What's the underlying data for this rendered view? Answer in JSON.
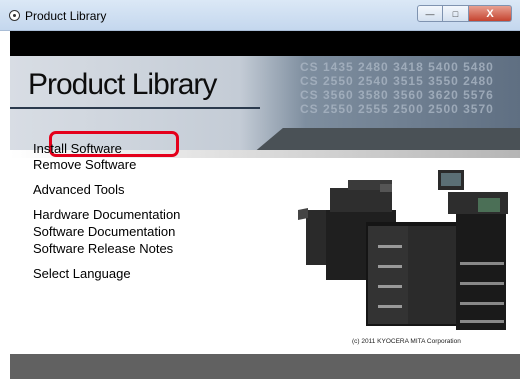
{
  "window": {
    "title": "Product Library",
    "controls": {
      "minimize": "—",
      "maximize": "□",
      "close": "X"
    }
  },
  "banner": {
    "title": "Product Library",
    "models": [
      "CS 1435 2480 3418 5400 5480",
      "CS 2550 2540 3515 3550 2480",
      "CS 3560 3580 3560 3620 5576",
      "CS 2550 2555 2500 2500 3570"
    ]
  },
  "menu": {
    "items": [
      {
        "label": "Install Software",
        "highlighted": true
      },
      {
        "label": "Remove Software"
      },
      {
        "label": "Advanced Tools"
      },
      {
        "label": "Hardware Documentation"
      },
      {
        "label": "Software Documentation"
      },
      {
        "label": "Software Release Notes"
      },
      {
        "label": "Select Language"
      }
    ]
  },
  "copyright": "(c) 2011 KYOCERA MITA Corporation",
  "colors": {
    "highlight": "#e4001b",
    "footer": "#616161",
    "topbar": "#000000"
  }
}
